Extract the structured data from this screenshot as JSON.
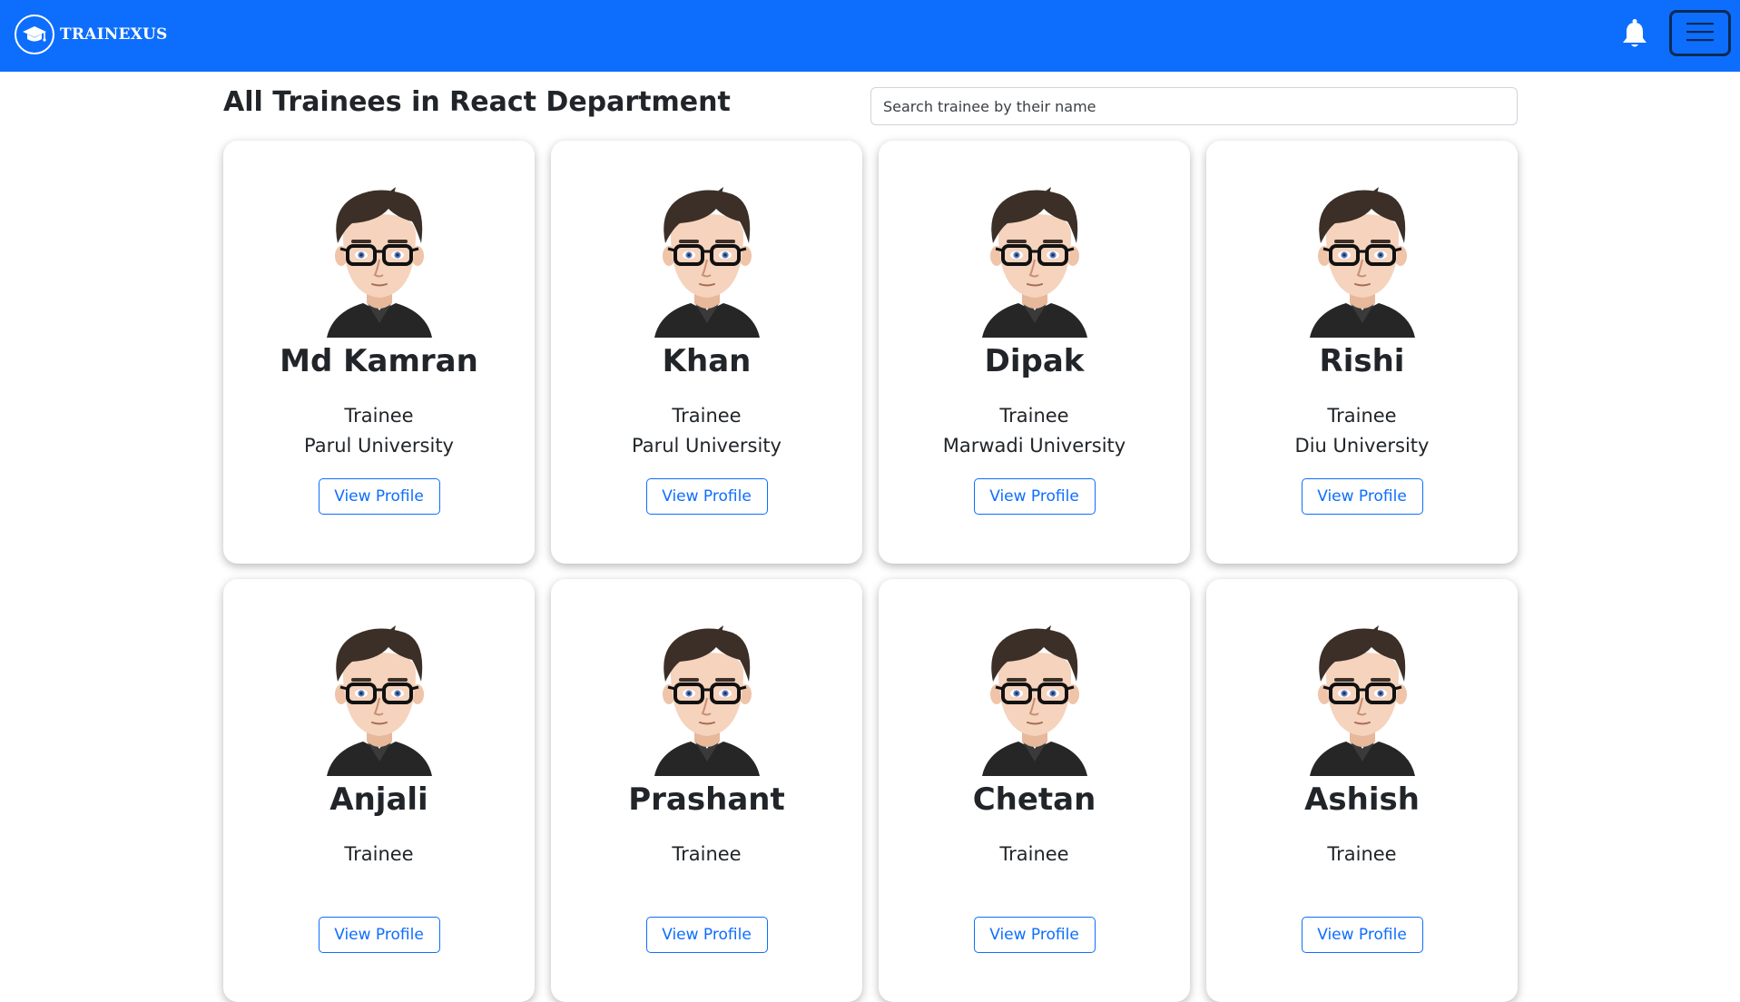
{
  "navbar": {
    "brand_name": "TRAINEXUS",
    "logo_icon": "graduation-cap-icon",
    "notification_icon": "bell-icon",
    "menu_icon": "hamburger-menu-icon",
    "background_color": "#0d6efd"
  },
  "page": {
    "title": "All Trainees in React Department"
  },
  "search": {
    "placeholder": "Search trainee by their name",
    "value": ""
  },
  "trainees": [
    {
      "name": "Md Kamran",
      "role": "Trainee",
      "university": "Parul University",
      "button_label": "View Profile"
    },
    {
      "name": "Khan",
      "role": "Trainee",
      "university": "Parul University",
      "button_label": "View Profile"
    },
    {
      "name": "Dipak",
      "role": "Trainee",
      "university": "Marwadi University",
      "button_label": "View Profile"
    },
    {
      "name": "Rishi",
      "role": "Trainee",
      "university": "Diu University",
      "button_label": "View Profile"
    },
    {
      "name": "Anjali",
      "role": "Trainee",
      "university": "",
      "button_label": "View Profile"
    },
    {
      "name": "Prashant",
      "role": "Trainee",
      "university": "",
      "button_label": "View Profile"
    },
    {
      "name": "Chetan",
      "role": "Trainee",
      "university": "",
      "button_label": "View Profile"
    },
    {
      "name": "Ashish",
      "role": "Trainee",
      "university": "",
      "button_label": "View Profile"
    }
  ],
  "colors": {
    "accent": "#0d6efd",
    "text": "#212529",
    "card_background": "#ffffff"
  }
}
